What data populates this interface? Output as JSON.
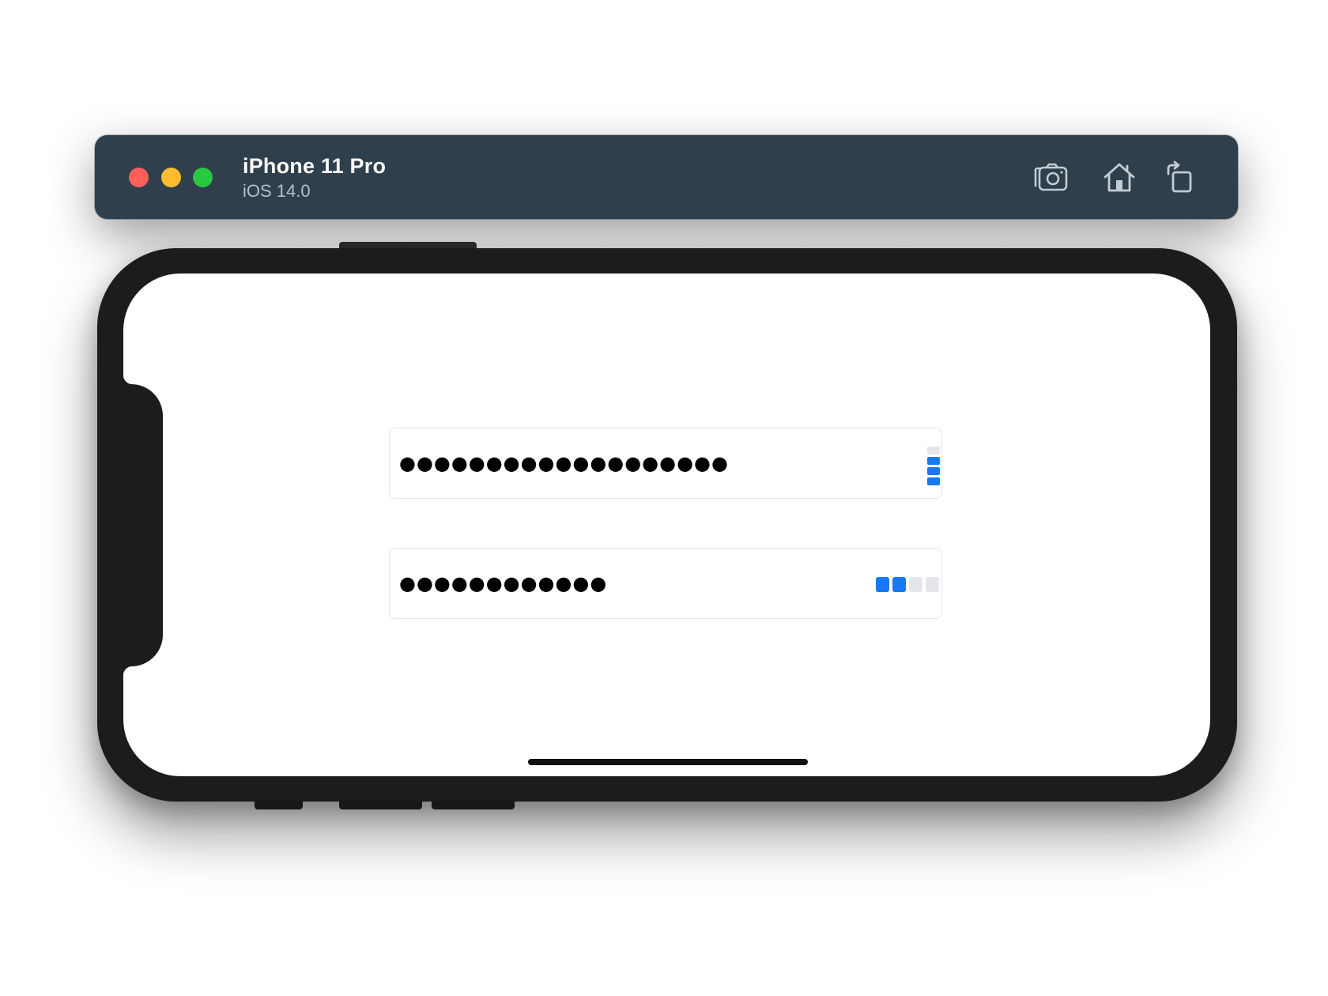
{
  "simulator": {
    "device_name": "iPhone 11 Pro",
    "os_version": "iOS 14.0",
    "toolbar": [
      {
        "icon": "screenshot-icon",
        "label": "Screenshot"
      },
      {
        "icon": "home-icon",
        "label": "Home"
      },
      {
        "icon": "rotate-icon",
        "label": "Rotate"
      }
    ]
  },
  "fields": [
    {
      "masked_value": "●●●●●●●●●●●●●●●●●●●",
      "strength": {
        "filled": 3,
        "total": 4,
        "orientation": "vertical"
      }
    },
    {
      "masked_value": "●●●●●●●●●●●●",
      "strength": {
        "filled": 2,
        "total": 4,
        "orientation": "horizontal"
      }
    }
  ],
  "colors": {
    "titlebar": "#2f3f4b",
    "meter_active": "#1778f2",
    "meter_inactive": "#e5e5ea",
    "traffic_close": "#fe5f57",
    "traffic_minimize": "#febc2e",
    "traffic_zoom": "#28c840"
  }
}
